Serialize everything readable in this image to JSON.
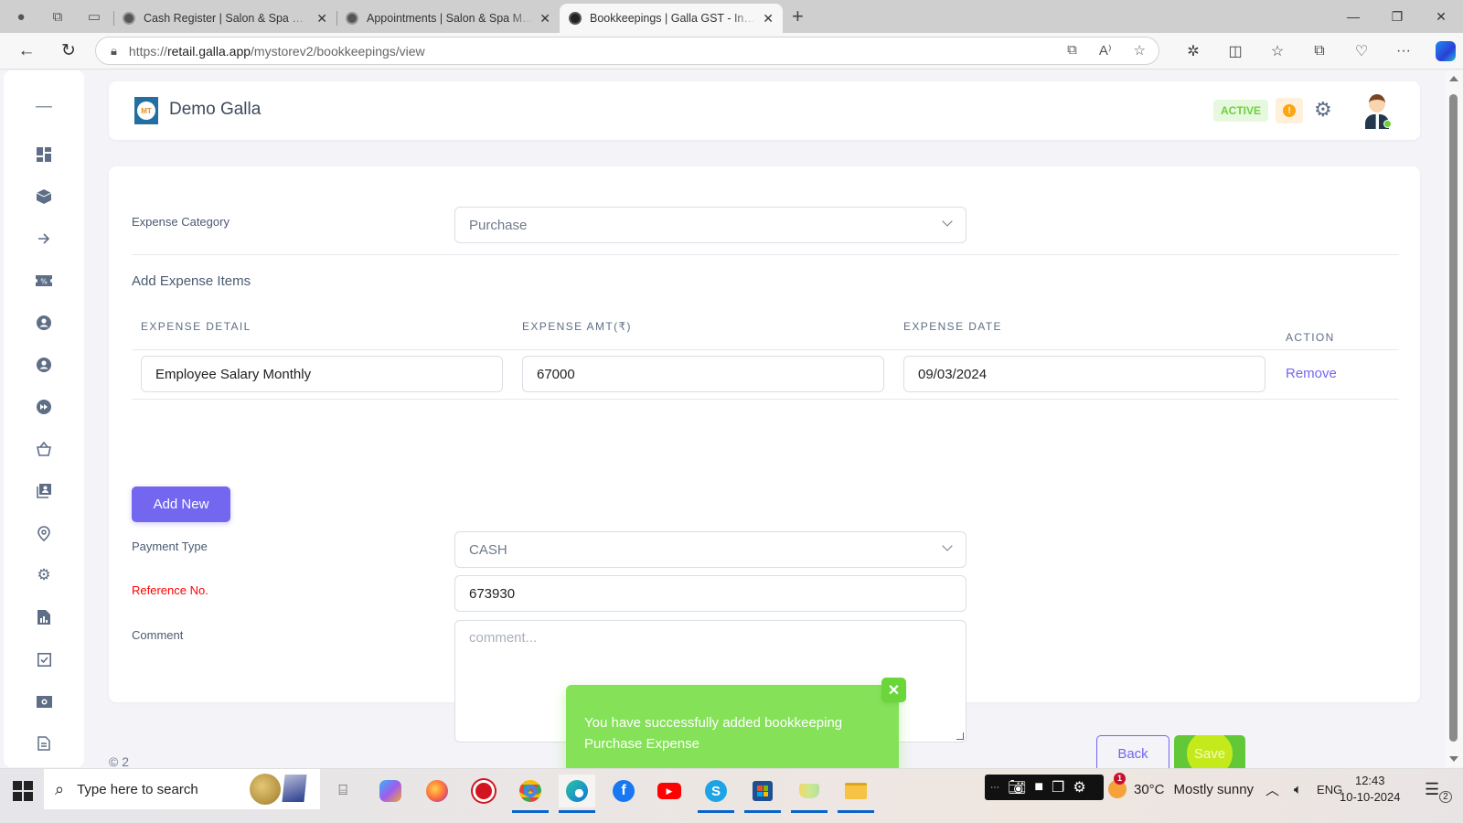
{
  "browser": {
    "tabs": [
      {
        "title": "Cash Register | Salon & Spa Management",
        "active": false
      },
      {
        "title": "Appointments | Salon & Spa Management",
        "active": false
      },
      {
        "title": "Bookkeepings | Galla GST - Inventory",
        "active": true
      }
    ],
    "new_tab": "+",
    "url_prefix": "https://",
    "url_domain": "retail.galla.app",
    "url_path": "/mystorev2/bookkeepings/view",
    "window_controls": {
      "minimize": "—",
      "restore": "❐",
      "close": "✕"
    }
  },
  "header": {
    "brand": "Demo Galla",
    "logo_text": "MT",
    "status_badge": "ACTIVE",
    "alert_icon": "!"
  },
  "sidebar": {
    "items": [
      {
        "icon": "collapse-icon"
      },
      {
        "icon": "dashboard-icon"
      },
      {
        "icon": "package-icon"
      },
      {
        "icon": "arrow-right-icon"
      },
      {
        "icon": "discount-ticket-icon"
      },
      {
        "icon": "user-circle-icon"
      },
      {
        "icon": "user-circle-icon"
      },
      {
        "icon": "fast-forward-icon"
      },
      {
        "icon": "basket-icon"
      },
      {
        "icon": "contacts-icon"
      },
      {
        "icon": "location-icon"
      },
      {
        "icon": "settings-icon"
      },
      {
        "icon": "report-icon"
      },
      {
        "icon": "checkbox-icon"
      },
      {
        "icon": "cash-icon"
      },
      {
        "icon": "document-icon"
      }
    ]
  },
  "form": {
    "expense_category_label": "Expense Category",
    "expense_category_value": "Purchase",
    "add_items_title": "Add Expense Items",
    "columns": {
      "detail": "EXPENSE DETAIL",
      "amount": "EXPENSE AMT(₹)",
      "date": "EXPENSE DATE",
      "action": "ACTION"
    },
    "rows": [
      {
        "detail": "Employee Salary Monthly",
        "amount": "67000",
        "date": "09/03/2024",
        "action": "Remove"
      }
    ],
    "add_new_label": "Add New",
    "payment_type_label": "Payment Type",
    "payment_type_value": "CASH",
    "reference_label": "Reference No.",
    "reference_value": "673930",
    "comment_label": "Comment",
    "comment_placeholder": "comment...",
    "comment_value": ""
  },
  "footer": {
    "copyright": "© 2",
    "back_label": "Back",
    "save_label": "Save"
  },
  "toast": {
    "message": "You have successfully added bookkeeping Purchase Expense",
    "close": "✕",
    "color": "#84e158"
  },
  "colors": {
    "primary": "#7367f0",
    "success": "#63c837",
    "required_label": "#ff0000"
  },
  "taskbar": {
    "search_placeholder": "Type here to search",
    "weather_temp": "30°C",
    "weather_text": "Mostly sunny",
    "weather_badge": "1",
    "language": "ENG",
    "time": "12:43",
    "date": "10-10-2024",
    "notification_count": "2"
  }
}
